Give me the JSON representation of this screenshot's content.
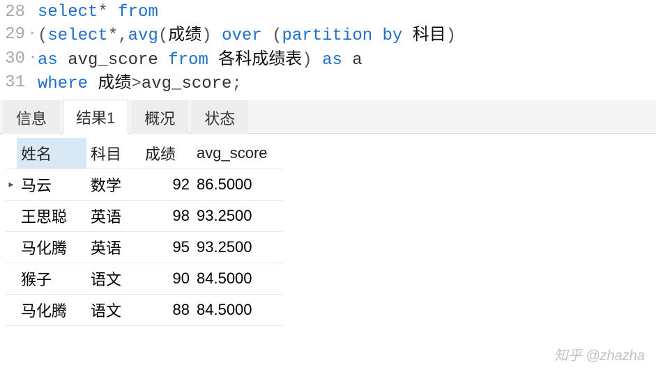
{
  "editor": {
    "lines": [
      {
        "num": "28",
        "fold": "",
        "tokens": [
          {
            "t": "select",
            "c": "kw"
          },
          {
            "t": "* ",
            "c": "op"
          },
          {
            "t": "from",
            "c": "kw"
          }
        ]
      },
      {
        "num": "29",
        "fold": "▸",
        "tokens": [
          {
            "t": "(",
            "c": "op"
          },
          {
            "t": "select",
            "c": "kw"
          },
          {
            "t": "*,",
            "c": "op"
          },
          {
            "t": "avg",
            "c": "kw"
          },
          {
            "t": "(",
            "c": "op"
          },
          {
            "t": "成绩",
            "c": "cjk"
          },
          {
            "t": ") ",
            "c": "op"
          },
          {
            "t": "over",
            "c": "kw"
          },
          {
            "t": " (",
            "c": "op"
          },
          {
            "t": "partition by",
            "c": "kw"
          },
          {
            "t": " ",
            "c": "op"
          },
          {
            "t": "科目",
            "c": "cjk"
          },
          {
            "t": ")",
            "c": "op"
          }
        ]
      },
      {
        "num": "30",
        "fold": "▾",
        "tokens": [
          {
            "t": "as",
            "c": "kw"
          },
          {
            "t": " avg_score ",
            "c": "txt"
          },
          {
            "t": "from",
            "c": "kw"
          },
          {
            "t": " ",
            "c": "op"
          },
          {
            "t": "各科成绩表",
            "c": "cjk"
          },
          {
            "t": ") ",
            "c": "op"
          },
          {
            "t": "as",
            "c": "kw"
          },
          {
            "t": " a",
            "c": "txt"
          }
        ]
      },
      {
        "num": "31",
        "fold": "",
        "tokens": [
          {
            "t": "where",
            "c": "kw"
          },
          {
            "t": " ",
            "c": "op"
          },
          {
            "t": "成绩",
            "c": "cjk"
          },
          {
            "t": ">",
            "c": "op"
          },
          {
            "t": "avg_score",
            "c": "txt"
          },
          {
            "t": ";",
            "c": "op"
          }
        ]
      }
    ]
  },
  "tabs": [
    {
      "id": "info",
      "label": "信息",
      "active": false
    },
    {
      "id": "result1",
      "label": "结果1",
      "active": true
    },
    {
      "id": "profile",
      "label": "概况",
      "active": false
    },
    {
      "id": "status",
      "label": "状态",
      "active": false
    }
  ],
  "grid": {
    "columns": [
      {
        "key": "name",
        "label": "姓名",
        "current": true,
        "numeric": false
      },
      {
        "key": "subject",
        "label": "科目",
        "current": false,
        "numeric": false
      },
      {
        "key": "score",
        "label": "成绩",
        "current": false,
        "numeric": true
      },
      {
        "key": "avg",
        "label": "avg_score",
        "current": false,
        "numeric": false
      }
    ],
    "rows": [
      {
        "current": true,
        "cells": [
          "马云",
          "数学",
          "92",
          "86.5000"
        ]
      },
      {
        "current": false,
        "cells": [
          "王思聪",
          "英语",
          "98",
          "93.2500"
        ]
      },
      {
        "current": false,
        "cells": [
          "马化腾",
          "英语",
          "95",
          "93.2500"
        ]
      },
      {
        "current": false,
        "cells": [
          "猴子",
          "语文",
          "90",
          "84.5000"
        ]
      },
      {
        "current": false,
        "cells": [
          "马化腾",
          "语文",
          "88",
          "84.5000"
        ]
      }
    ]
  },
  "watermark": "知乎 @zhazha",
  "chart_data": {
    "type": "table",
    "title": "结果1",
    "columns": [
      "姓名",
      "科目",
      "成绩",
      "avg_score"
    ],
    "rows": [
      [
        "马云",
        "数学",
        92,
        86.5
      ],
      [
        "王思聪",
        "英语",
        98,
        93.25
      ],
      [
        "马化腾",
        "英语",
        95,
        93.25
      ],
      [
        "猴子",
        "语文",
        90,
        84.5
      ],
      [
        "马化腾",
        "语文",
        88,
        84.5
      ]
    ]
  }
}
